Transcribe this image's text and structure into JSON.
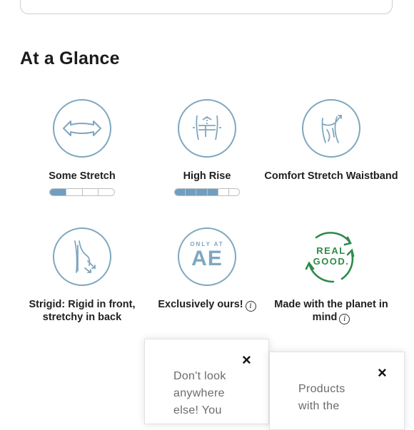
{
  "section": {
    "title": "At a Glance"
  },
  "features": [
    {
      "label": "Some Stretch",
      "icon": "stretch-arrows-icon",
      "meter_level": 1,
      "meter_total": 4
    },
    {
      "label": "High Rise",
      "icon": "high-rise-waist-icon",
      "meter_level": 3,
      "meter_total": 5
    },
    {
      "label": "Comfort Stretch Waistband",
      "icon": "waistband-stretch-icon"
    },
    {
      "label": "Strigid: Rigid in front, stretchy in back",
      "icon": "strigid-leg-icon"
    },
    {
      "label": "Exclusively ours!",
      "icon": "only-at-ae-icon",
      "badge_small": "ONLY AT",
      "badge_big": "AE",
      "info": "i"
    },
    {
      "label": "Made with the planet in mind",
      "icon": "real-good-recycle-icon",
      "badge_line1": "REAL",
      "badge_line2": "GOOD.",
      "info": "i"
    }
  ],
  "popups": [
    {
      "close": "×",
      "text": "Don't look anywhere else! You"
    },
    {
      "close": "×",
      "text": "Products with the"
    }
  ],
  "colors": {
    "icon_blue": "#7fa7bf",
    "meter_fill": "#6f9fc0",
    "real_good_green": "#2e8a49"
  }
}
